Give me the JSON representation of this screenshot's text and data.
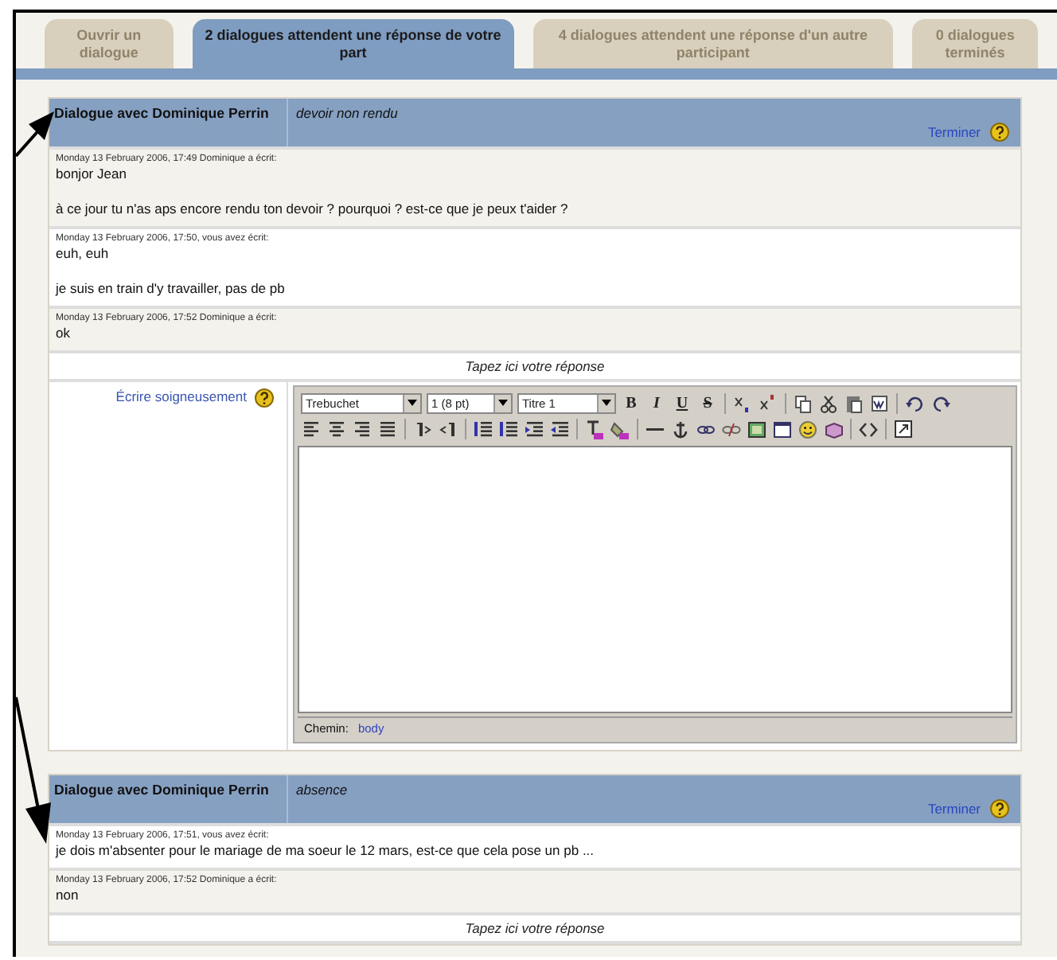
{
  "tabs": [
    {
      "label": "Ouvrir un dialogue",
      "selected": false
    },
    {
      "label": "2 dialogues attendent une réponse de votre part",
      "selected": true
    },
    {
      "label": "4 dialogues attendent une réponse d'un autre participant",
      "selected": false
    },
    {
      "label": "0 dialogues terminés",
      "selected": false
    }
  ],
  "dialogues": [
    {
      "title": "Dialogue avec Dominique Perrin",
      "subject": "devoir non rendu",
      "close_link": "Terminer",
      "messages": [
        {
          "kind": "received",
          "meta": "Monday 13 February 2006, 17:49 Dominique a écrit:",
          "lines": [
            "bonjor Jean",
            "à ce jour tu n'as aps encore rendu ton devoir ? pourquoi ? est-ce que je peux t'aider ?"
          ]
        },
        {
          "kind": "sent",
          "meta": "Monday 13 February 2006, 17:50, vous avez écrit:",
          "lines": [
            "euh, euh",
            "je suis en train d'y travailler, pas de pb"
          ]
        },
        {
          "kind": "received",
          "meta": "Monday 13 February 2006, 17:52 Dominique a écrit:",
          "lines": [
            "ok"
          ]
        }
      ],
      "reply_prompt": "Tapez ici votre réponse",
      "editor": {
        "label": "Écrire soigneusement",
        "font": "Trebuchet",
        "size": "1 (8 pt)",
        "format": "Titre 1",
        "text_buttons": [
          "B",
          "I",
          "U",
          "S"
        ],
        "path_label": "Chemin:",
        "path": "body"
      }
    },
    {
      "title": "Dialogue avec Dominique Perrin",
      "subject": "absence",
      "close_link": "Terminer",
      "messages": [
        {
          "kind": "sent",
          "meta": "Monday 13 February 2006, 17:51, vous avez écrit:",
          "lines": [
            "je dois m'absenter pour le mariage de ma soeur le 12 mars, est-ce que cela pose un pb ..."
          ]
        },
        {
          "kind": "received",
          "meta": "Monday 13 February 2006, 17:52 Dominique a écrit:",
          "lines": [
            "non"
          ]
        }
      ],
      "reply_prompt": "Tapez ici votre réponse"
    }
  ]
}
